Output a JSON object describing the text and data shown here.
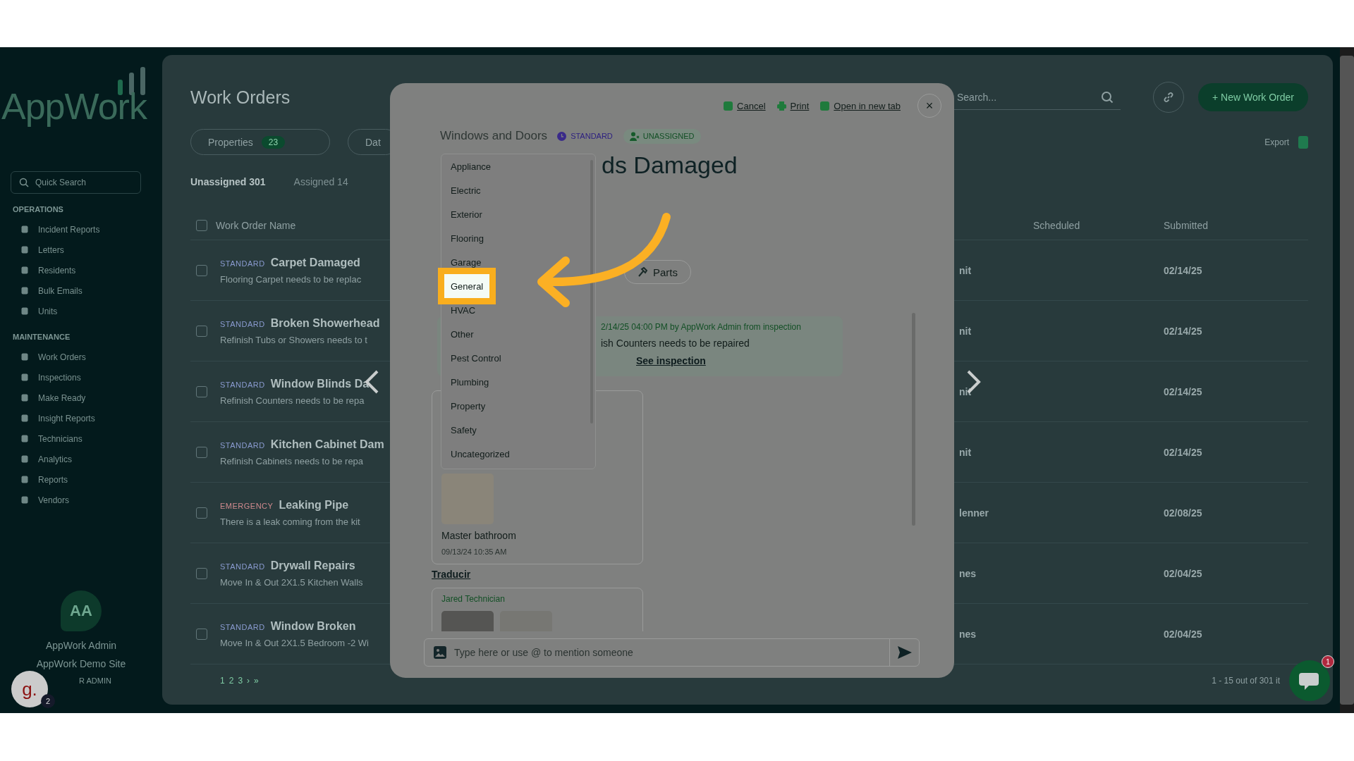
{
  "sidebar": {
    "logo": "AppWork",
    "search": {
      "placeholder": "Quick Search"
    },
    "sections": [
      {
        "heading": "OPERATIONS",
        "items": [
          "Incident Reports",
          "Letters",
          "Residents",
          "Bulk Emails",
          "Units"
        ]
      },
      {
        "heading": "MAINTENANCE",
        "items": [
          "Work Orders",
          "Inspections",
          "Make Ready",
          "Insight Reports",
          "Technicians",
          "Analytics",
          "Reports",
          "Vendors"
        ]
      }
    ],
    "user": {
      "initials": "AA",
      "name": "AppWork Admin",
      "site": "AppWork Demo Site",
      "role": "R ADMIN"
    }
  },
  "help_bubble": {
    "letter": "g.",
    "badge": "2"
  },
  "page": {
    "title": "Work Orders",
    "search": {
      "placeholder": "Search..."
    },
    "new_button": "+ New Work Order",
    "export": "Export",
    "filters": [
      {
        "label": "Properties",
        "badge": "23"
      },
      {
        "label": "Dat"
      }
    ],
    "tabs": [
      {
        "label": "Unassigned 301",
        "selected": true
      },
      {
        "label": "Assigned 14",
        "selected": false
      }
    ],
    "table": {
      "select_all_checked": false,
      "columns": [
        "Work Order Name",
        "Scheduled",
        "Submitted"
      ],
      "rows": [
        {
          "checked": false,
          "kind": "standard",
          "priority": "STANDARD",
          "name": "Carpet Damaged",
          "description": "Flooring Carpet needs to be replac",
          "column_3": "nit",
          "submitted": "02/14/25"
        },
        {
          "checked": false,
          "kind": "standard",
          "priority": "STANDARD",
          "name": "Broken Showerhead",
          "description": "Refinish Tubs or Showers needs to t",
          "column_3": "nit",
          "submitted": "02/14/25"
        },
        {
          "checked": false,
          "kind": "standard",
          "priority": "STANDARD",
          "name": "Window Blinds Da",
          "description": "Refinish Counters needs to be repa",
          "column_3": "nit",
          "submitted": "02/14/25"
        },
        {
          "checked": false,
          "kind": "standard",
          "priority": "STANDARD",
          "name": "Kitchen Cabinet Dam",
          "description": "Refinish Cabinets needs to be repa",
          "column_3": "nit",
          "submitted": "02/14/25"
        },
        {
          "checked": false,
          "kind": "emergency",
          "priority": "EMERGENCY",
          "name": "Leaking Pipe",
          "description": "There is a leak coming from the kit",
          "column_3": "lenner",
          "submitted": "02/08/25"
        },
        {
          "checked": false,
          "kind": "standard",
          "priority": "STANDARD",
          "name": "Drywall Repairs",
          "description": "Move In & Out 2X1.5 Kitchen Walls",
          "column_3": "nes",
          "submitted": "02/04/25"
        },
        {
          "checked": false,
          "kind": "standard",
          "priority": "STANDARD",
          "name": "Window Broken",
          "description": "Move In & Out 2X1.5 Bedroom -2 Wi",
          "column_3": "nes",
          "submitted": "02/04/25"
        }
      ]
    },
    "pagination": [
      "1",
      "2",
      "3",
      "›",
      "»"
    ],
    "range": "1 - 15 out of 301 it"
  },
  "modal": {
    "actions": [
      "Cancel",
      "Print",
      "Open in new tab"
    ],
    "close": "×",
    "category": "Windows and Doors",
    "badges": [
      {
        "kind": "priority",
        "label": "STANDARD"
      },
      {
        "kind": "assignment",
        "label": "UNASSIGNED"
      }
    ],
    "title": "ds Damaged",
    "section_tab": "Parts",
    "dropdown": {
      "options": [
        {
          "label": "Appliance",
          "selected": false
        },
        {
          "label": "Electric",
          "selected": false
        },
        {
          "label": "Exterior",
          "selected": false
        },
        {
          "label": "Flooring",
          "selected": false
        },
        {
          "label": "Garage",
          "selected": false
        },
        {
          "label": "General",
          "selected": true
        },
        {
          "label": "HVAC",
          "selected": false
        },
        {
          "label": "Other",
          "selected": false
        },
        {
          "label": "Pest Control",
          "selected": false
        },
        {
          "label": "Plumbing",
          "selected": false
        },
        {
          "label": "Property",
          "selected": false
        },
        {
          "label": "Safety",
          "selected": false
        },
        {
          "label": "Uncategorized",
          "selected": false
        }
      ]
    },
    "note": {
      "meta": "2/14/25 04:00 PM  by AppWork Admin from inspection",
      "text": "ish Counters needs to be repaired",
      "link": "See inspection"
    },
    "photo_card": {
      "caption": "Master bathroom",
      "time": "09/13/24 10:35 AM"
    },
    "translate_link": "Traducir",
    "comment_card": {
      "author": "Jared Technician"
    },
    "composer": {
      "placeholder": "Type here or use @ to mention someone"
    }
  },
  "chat_bubble": {
    "badge": "1"
  }
}
